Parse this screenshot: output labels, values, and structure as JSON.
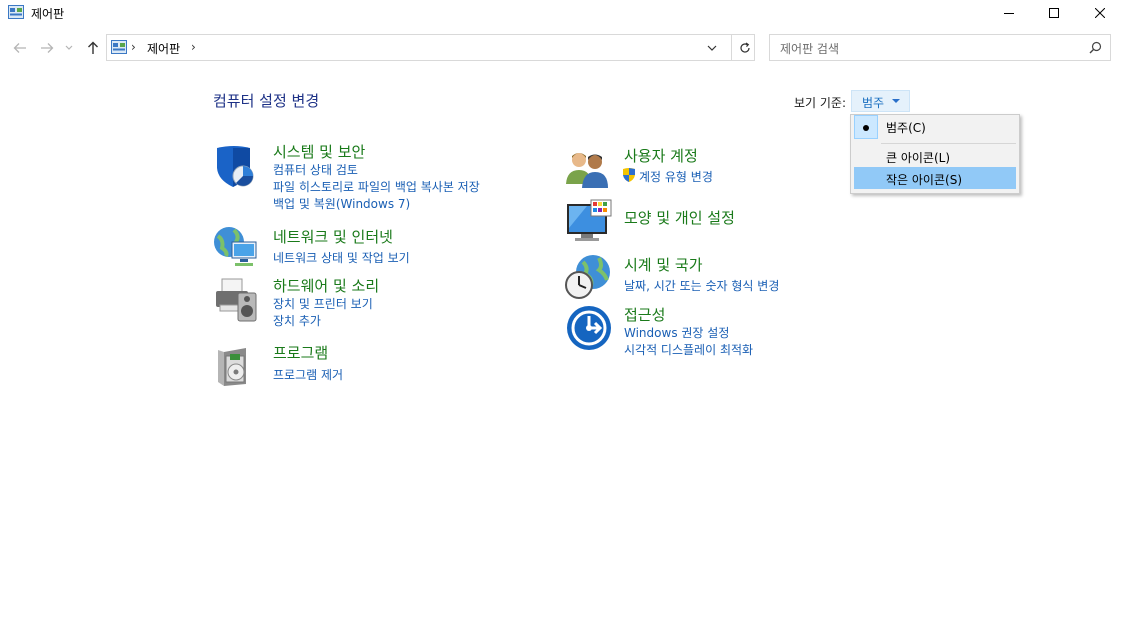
{
  "window": {
    "title": "제어판"
  },
  "address": {
    "path": "제어판",
    "separator": "›"
  },
  "search": {
    "placeholder": "제어판 검색"
  },
  "page": {
    "heading": "컴퓨터 설정 변경"
  },
  "view_by": {
    "label": "보기 기준:",
    "selected": "범주",
    "menu": [
      {
        "label": "범주(C)",
        "checked": true
      },
      {
        "label": "큰 아이콘(L)",
        "checked": false
      },
      {
        "label": "작은 아이콘(S)",
        "checked": false,
        "highlighted": true
      }
    ]
  },
  "categories": {
    "system": {
      "title": "시스템 및 보안",
      "links": [
        "컴퓨터 상태 검토",
        "파일 히스토리로 파일의 백업 복사본 저장",
        "백업 및 복원(Windows 7)"
      ],
      "icon": "shield-icon"
    },
    "network": {
      "title": "네트워크 및 인터넷",
      "links": [
        "네트워크 상태 및 작업 보기"
      ],
      "icon": "network-globe-icon"
    },
    "hardware": {
      "title": "하드웨어 및 소리",
      "links": [
        "장치 및 프린터 보기",
        "장치 추가"
      ],
      "icon": "printer-speaker-icon"
    },
    "programs": {
      "title": "프로그램",
      "links": [
        "프로그램 제거"
      ],
      "icon": "programs-box-icon"
    },
    "users": {
      "title": "사용자 계정",
      "links": [
        "계정 유형 변경"
      ],
      "icon": "users-icon"
    },
    "appearance": {
      "title": "모양 및 개인 설정",
      "links": [],
      "icon": "monitor-palette-icon"
    },
    "clock": {
      "title": "시계 및 국가",
      "links": [
        "날짜, 시간 또는 숫자 형식 변경"
      ],
      "icon": "globe-clock-icon"
    },
    "ease": {
      "title": "접근성",
      "links": [
        "Windows 권장 설정",
        "시각적 디스플레이 최적화"
      ],
      "icon": "accessibility-icon"
    }
  }
}
